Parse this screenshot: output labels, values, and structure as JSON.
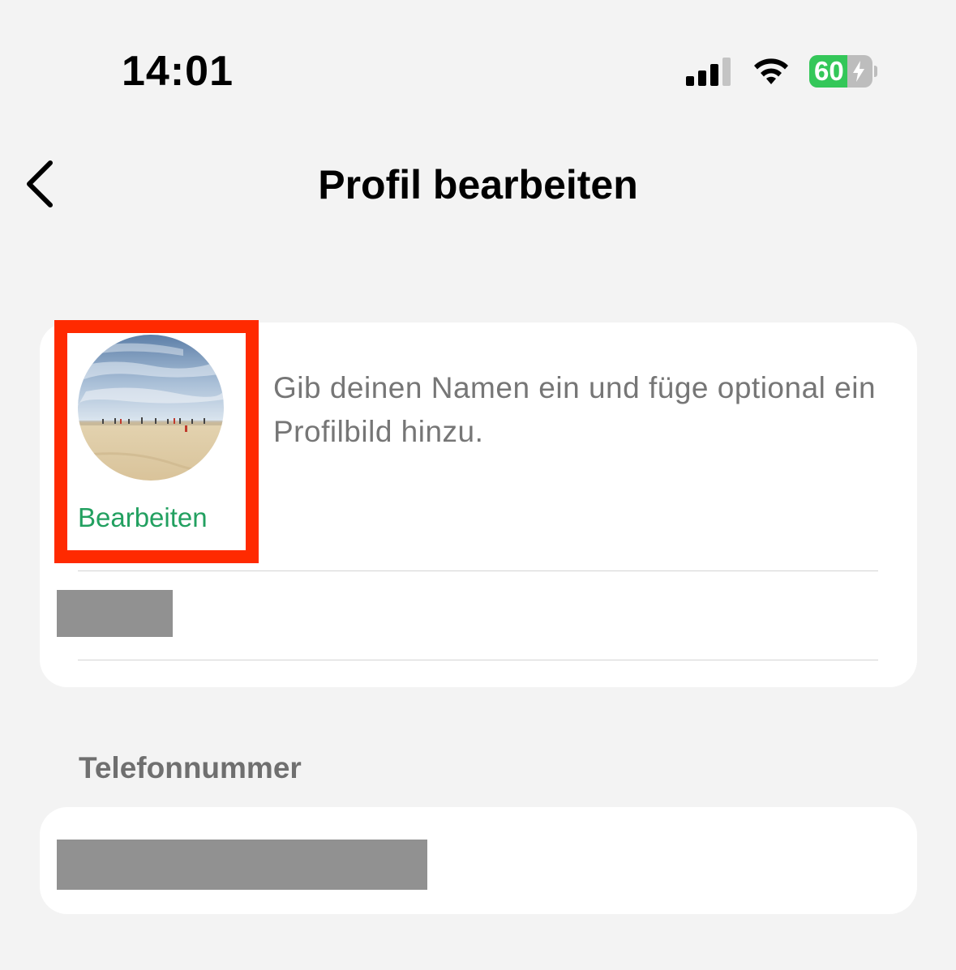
{
  "status_bar": {
    "time": "14:01",
    "battery_level": "60",
    "battery_charge_fraction": 0.6,
    "icons": [
      "signal-icon",
      "wifi-icon",
      "battery-icon",
      "charging-bolt-icon"
    ]
  },
  "nav": {
    "title": "Profil bearbeiten",
    "back_icon": "chevron-left-icon"
  },
  "profile": {
    "avatar_image": "beach photo",
    "edit_label": "Bearbeiten",
    "hint": "Gib deinen Namen ein und füge optional ein Profilbild hinzu.",
    "name_value": ""
  },
  "phone": {
    "section_label": "Telefonnummer",
    "value": ""
  },
  "colors": {
    "background": "#f3f3f3",
    "card": "#ffffff",
    "accent_green": "#22a060",
    "highlight_red": "#ff2a00",
    "redaction_gray": "#919191",
    "battery_green": "#34c759"
  }
}
